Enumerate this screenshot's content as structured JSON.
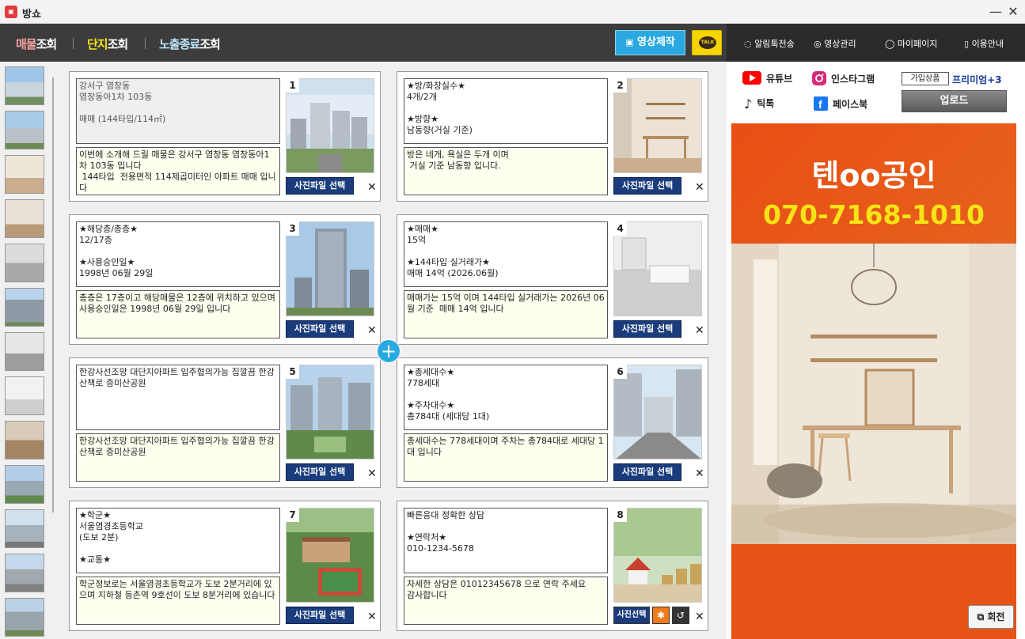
{
  "window": {
    "title": "방쇼",
    "logo_text": "방쇼",
    "minimize": "—",
    "close": "✕"
  },
  "nav": {
    "items": [
      {
        "hl": "매물",
        "rest": "조회",
        "color": "#f4a3a3"
      },
      {
        "hl": "단지",
        "rest": "조회",
        "color": "#f7e417"
      },
      {
        "hl": "노출종료",
        "rest": "조회",
        "color": "#bfe8ff"
      }
    ],
    "video_button": "영상제작",
    "talk_label": "TALK"
  },
  "right_nav": [
    "알림톡전송",
    "영상관리",
    "마이페이지",
    "이용안내"
  ],
  "cards": [
    {
      "num": "1",
      "top": "강서구 염창동\n염창동아1차 103동\n\n매매 (144타입/114㎡)",
      "top_grey": true,
      "bottom": "이번에 소개해 드릴 매물은 강서구 염창동 염창동아1차 103동 입니다\n 144타입  전용면적 114제곱미터인 아파트 매매 입니다",
      "button": "사진파일 선택",
      "photo": "building"
    },
    {
      "num": "2",
      "top": "★방/화장실수★\n4개/2개\n\n★방향★\n남동향(거실 기준)",
      "top_grey": false,
      "bottom": "방은 네개, 욕실은 두개 이며\n 거실 기준 남동향 입니다.",
      "button": "사진파일 선택",
      "photo": "room"
    },
    {
      "num": "3",
      "top": "★해당층/총층★\n12/17층\n\n★사용승인일★\n1998년 06월 29일",
      "top_grey": false,
      "bottom": "총층은 17층이고 해당매물은 12층에 위치하고 있으며 사용승인일은 1998년 06월 29일 입니다",
      "button": "사진파일 선택",
      "photo": "tower"
    },
    {
      "num": "4",
      "top": "★매매★\n15억\n\n★144타입 실거래가★\n매매 14억 (2026.06월)",
      "top_grey": false,
      "bottom": "매매가는 15억 이며 144타입 실거래가는 2026년 06월 기준  매매 14억 입니다",
      "button": "사진파일 선택",
      "photo": "kitchen"
    },
    {
      "num": "5",
      "top": "한강사선조망 대단지아파트 입주협의가능 집깔끔 한강산책로 증미산공원",
      "top_grey": false,
      "bottom": "한강사선조망 대단지아파트 입주협의가능 집깔끔 한강산책로 증미산공원",
      "button": "사진파일 선택",
      "photo": "complex"
    },
    {
      "num": "6",
      "top": "★총세대수★\n778세대\n\n★주차대수★\n총784대 (세대당 1대)",
      "top_grey": false,
      "bottom": "총세대수는 778세대이며 주차는 총784대로 세대당 1대 입니다",
      "button": "사진파일 선택",
      "photo": "parking"
    },
    {
      "num": "7",
      "top": "★학군★\n서울염경초등학교\n(도보 2분)\n\n★교통★",
      "top_grey": false,
      "bottom": "학군정보로는 서울염경초등학교가 도보 2분거리에 있으며 지하철 등촌역 9호선이 도보 8분거리에 있습니다",
      "button": "사진파일 선택",
      "photo": "school"
    },
    {
      "num": "8",
      "top": "빠른응대 정확한 상담\n\n★연락처★\n010-1234-5678",
      "top_grey": false,
      "bottom": "자세한 상담은 01012345678 으로 연락 주세요\n감사합니다",
      "button": "사진선택",
      "photo": "coins"
    }
  ],
  "close_x": "✕",
  "plus": "+",
  "social": {
    "youtube": "유튜브",
    "instagram": "인스타그램",
    "tiktok": "틱톡",
    "facebook": "페이스북"
  },
  "membership": {
    "label": "가입상품",
    "tier": "프리미엄+3"
  },
  "upload_button": "업로드",
  "poster": {
    "name": "텐oo공인",
    "phone": "070-7168-1010"
  },
  "rotate_button": "회전"
}
